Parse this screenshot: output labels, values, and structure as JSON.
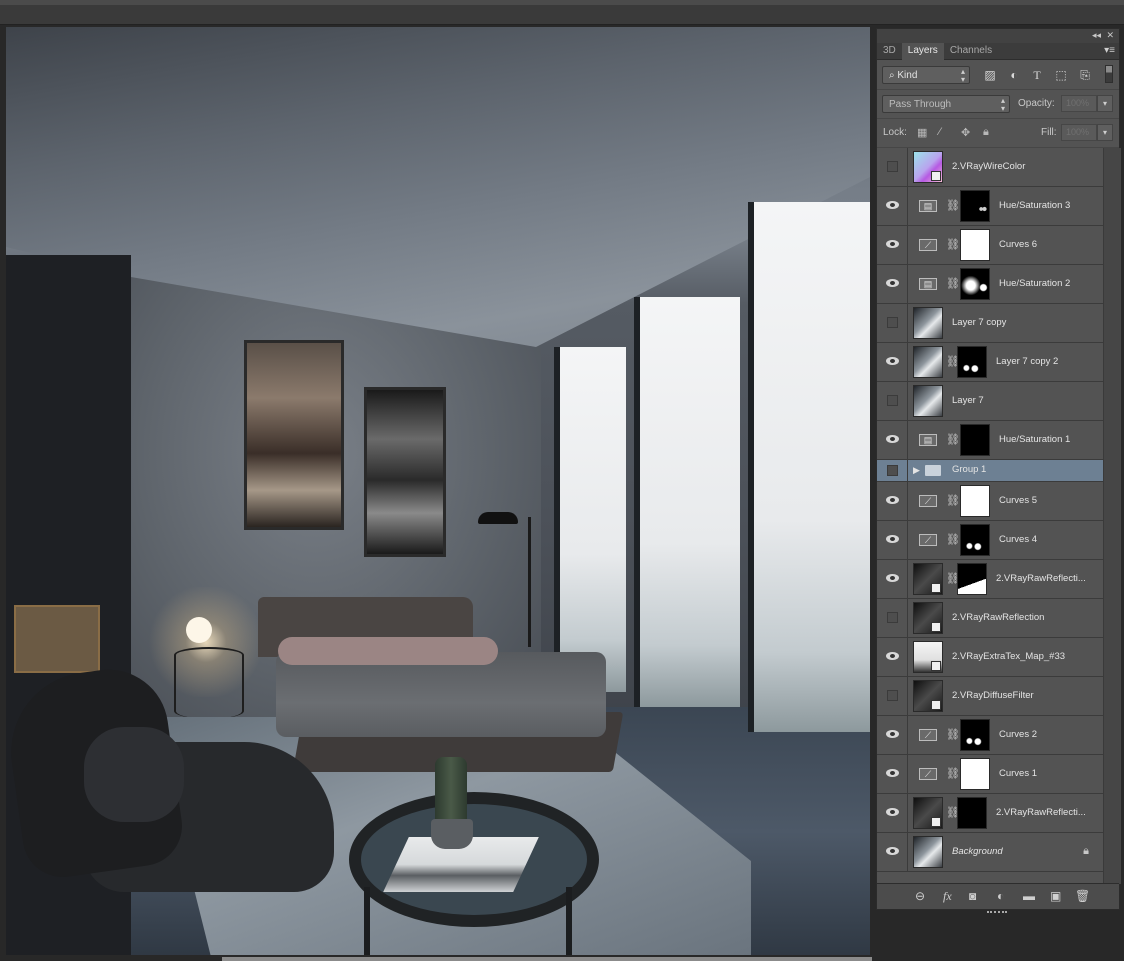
{
  "app": {
    "name": "Photoshop",
    "canvas_image": "bedroom-interior-render"
  },
  "colors": {
    "panel_bg": "#535353",
    "selected_row": "#6d8093",
    "workspace_bg": "#282828"
  },
  "panel": {
    "collapse_label": "◂◂",
    "close_label": "✕",
    "tabs": [
      {
        "label": "3D",
        "active": false
      },
      {
        "label": "Layers",
        "active": true
      },
      {
        "label": "Channels",
        "active": false
      }
    ],
    "menu_icon": "panel-menu-icon",
    "filter": {
      "kind_label": "Kind",
      "icons": [
        "pixel-filter-icon",
        "adjustment-filter-icon",
        "type-filter-icon",
        "shape-filter-icon",
        "smart-object-filter-icon"
      ]
    },
    "blend_mode": "Pass Through",
    "opacity_label": "Opacity:",
    "opacity_value": "100%",
    "lock_label": "Lock:",
    "lock_icons": [
      "lock-transparent-icon",
      "lock-image-icon",
      "lock-position-icon",
      "lock-all-icon"
    ],
    "fill_label": "Fill:",
    "fill_value": "100%"
  },
  "layers": [
    {
      "name": "2.VRayWireColor",
      "visible": false,
      "type": "smart",
      "thumb": "wire"
    },
    {
      "name": "Hue/Saturation 3",
      "visible": true,
      "type": "adjustment",
      "adj": "hue-sat",
      "mask": "dots"
    },
    {
      "name": "Curves 6",
      "visible": true,
      "type": "adjustment",
      "adj": "curves",
      "mask": "white"
    },
    {
      "name": "Hue/Saturation 2",
      "visible": true,
      "type": "adjustment",
      "adj": "hue-sat",
      "mask": "blobs"
    },
    {
      "name": "Layer 7 copy",
      "visible": false,
      "type": "pixel",
      "thumb": "photo"
    },
    {
      "name": "Layer 7 copy 2",
      "visible": true,
      "type": "pixel-mask",
      "thumb": "photo",
      "mask": "spots"
    },
    {
      "name": "Layer 7",
      "visible": false,
      "type": "pixel",
      "thumb": "photo"
    },
    {
      "name": "Hue/Saturation 1",
      "visible": true,
      "type": "adjustment",
      "adj": "hue-sat",
      "mask": "black"
    },
    {
      "name": "Group 1",
      "visible": false,
      "type": "group",
      "selected": true
    },
    {
      "name": "Curves 5",
      "visible": true,
      "type": "adjustment",
      "adj": "curves",
      "mask": "white"
    },
    {
      "name": "Curves 4",
      "visible": true,
      "type": "adjustment",
      "adj": "curves",
      "mask": "spots"
    },
    {
      "name": "2.VRayRawReflecti...",
      "visible": true,
      "type": "smart-mask",
      "thumb": "diffuse",
      "mask": "shore"
    },
    {
      "name": "2.VRayRawReflection",
      "visible": false,
      "type": "smart",
      "thumb": "diffuse"
    },
    {
      "name": "2.VRayExtraTex_Map_#33",
      "visible": true,
      "type": "smart",
      "thumb": "extra"
    },
    {
      "name": "2.VRayDiffuseFilter",
      "visible": false,
      "type": "smart",
      "thumb": "diffuse"
    },
    {
      "name": "Curves 2",
      "visible": true,
      "type": "adjustment",
      "adj": "curves",
      "mask": "spots"
    },
    {
      "name": "Curves 1",
      "visible": true,
      "type": "adjustment",
      "adj": "curves",
      "mask": "white"
    },
    {
      "name": "2.VRayRawReflecti...",
      "visible": true,
      "type": "smart-mask",
      "thumb": "diffuse",
      "mask": "black"
    },
    {
      "name": "Background",
      "visible": true,
      "type": "background",
      "thumb": "photo",
      "locked": true
    }
  ],
  "footer": {
    "icons": [
      "link-layers-icon",
      "fx-icon",
      "add-mask-icon",
      "new-adjustment-icon",
      "new-group-icon",
      "new-layer-icon",
      "delete-layer-icon"
    ],
    "glyphs": [
      "⊖",
      "fx",
      "◙",
      "◐",
      "▬",
      "▣",
      "🗑"
    ]
  }
}
